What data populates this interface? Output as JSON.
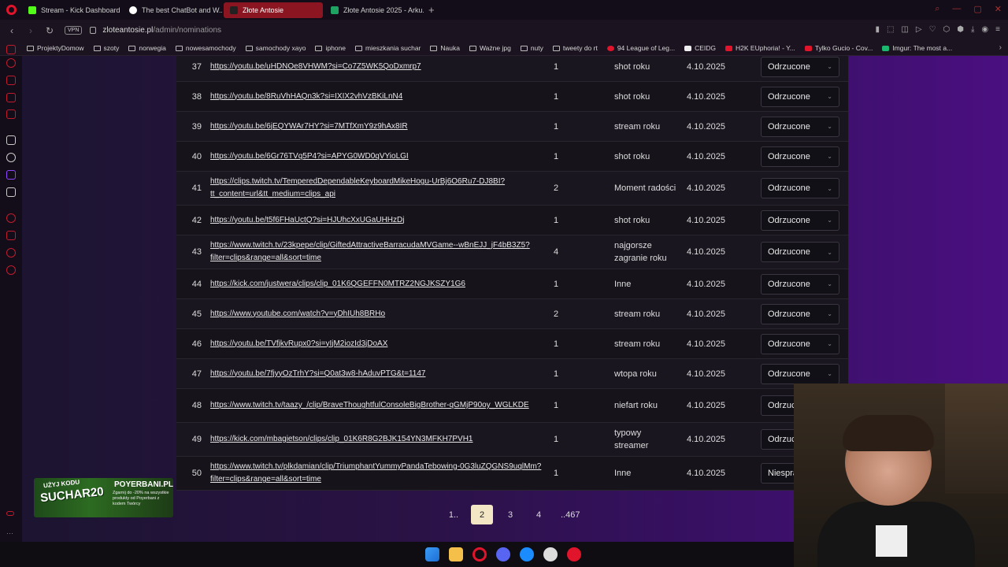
{
  "browser": {
    "tabs": [
      {
        "label": "Stream - Kick Dashboard",
        "favicon_color": "#53fc18"
      },
      {
        "label": "The best ChatBot and W...",
        "favicon_color": "#ffffff"
      },
      {
        "label": "Złote Antosie",
        "favicon_color": "#222222"
      },
      {
        "label": "Złote Antosie 2025 - Arku...",
        "favicon_color": "#1ea362"
      }
    ],
    "url_host": "zloteantosie.pl",
    "url_path": "/admin/nominations",
    "vpn_label": "VPN",
    "bookmarks": [
      "ProjektyDomow",
      "szoty",
      "norwegia",
      "nowesamochody",
      "samochody xayo",
      "iphone",
      "mieszkania suchar",
      "Nauka",
      "Ważne jpg",
      "nuty",
      "tweety do rt",
      "94 League of Leg...",
      "CEIDG",
      "H2K EUphoria! - Y...",
      "Tylko Gucio - Cov...",
      "Imgur: The most a..."
    ]
  },
  "table": {
    "rows": [
      {
        "num": "37",
        "url": "https://youtu.be/uHDNOe8VHWM?si=Co7Z5WK5QoDxmrp7",
        "count": "1",
        "category": "shot roku",
        "date": "4.10.2025",
        "status": "Odrzucone"
      },
      {
        "num": "38",
        "url": "https://youtu.be/8RuVhHAQn3k?si=IXIX2vhVzBKiLnN4",
        "count": "1",
        "category": "shot roku",
        "date": "4.10.2025",
        "status": "Odrzucone"
      },
      {
        "num": "39",
        "url": "https://youtu.be/6jEQYWAr7HY?si=7MTfXmY9z9hAx8IR",
        "count": "1",
        "category": "stream roku",
        "date": "4.10.2025",
        "status": "Odrzucone"
      },
      {
        "num": "40",
        "url": "https://youtu.be/6Gr76TVq5P4?si=APYG0WD0qVYioLGI",
        "count": "1",
        "category": "shot roku",
        "date": "4.10.2025",
        "status": "Odrzucone"
      },
      {
        "num": "41",
        "url": "https://clips.twitch.tv/TemperedDependableKeyboardMikeHogu-UrBj6O6Ru7-DJ8BI?tt_content=url&tt_medium=clips_api",
        "count": "2",
        "category": "Moment radości",
        "date": "4.10.2025",
        "status": "Odrzucone"
      },
      {
        "num": "42",
        "url": "https://youtu.be/t5f6FHaUctQ?si=HJUhcXxUGaUHHzDj",
        "count": "1",
        "category": "shot roku",
        "date": "4.10.2025",
        "status": "Odrzucone"
      },
      {
        "num": "43",
        "url": "https://www.twitch.tv/23kpepe/clip/GiftedAttractiveBarracudaMVGame--wBnEJJ_jF4bB3Z5?filter=clips&range=all&sort=time",
        "count": "4",
        "category": "najgorsze zagranie roku",
        "date": "4.10.2025",
        "status": "Odrzucone"
      },
      {
        "num": "44",
        "url": "https://kick.com/justwera/clips/clip_01K6QGEFFN0MTRZ2NGJKSZY1G6",
        "count": "1",
        "category": "Inne",
        "date": "4.10.2025",
        "status": "Odrzucone"
      },
      {
        "num": "45",
        "url": "https://www.youtube.com/watch?v=yDhIUh8BRHo",
        "count": "2",
        "category": "stream roku",
        "date": "4.10.2025",
        "status": "Odrzucone"
      },
      {
        "num": "46",
        "url": "https://youtu.be/TVfjkvRupx0?si=yIjM2iozId3jDoAX",
        "count": "1",
        "category": "stream roku",
        "date": "4.10.2025",
        "status": "Odrzucone"
      },
      {
        "num": "47",
        "url": "https://youtu.be/7fjyyOzTrhY?si=Q0at3w8-hAduvPTG&t=1147",
        "count": "1",
        "category": "wtopa roku",
        "date": "4.10.2025",
        "status": "Odrzucone"
      },
      {
        "num": "48",
        "url": "https://www.twitch.tv/taazy_/clip/BraveThoughtfulConsoleBigBrother-qGMjP90oy_WGLKDE",
        "count": "1",
        "category": "niefart roku",
        "date": "4.10.2025",
        "status": "Odrzuc"
      },
      {
        "num": "49",
        "url": "https://kick.com/mbagietson/clips/clip_01K6R8G2BJK154YN3MFKH7PVH1",
        "count": "1",
        "category": "typowy streamer",
        "date": "4.10.2025",
        "status": "Odrzuc"
      },
      {
        "num": "50",
        "url": "https://www.twitch.tv/plkdamian/clip/TriumphantYummyPandaTebowing-0G3luZQGNS9uqlMm?filter=clips&range=all&sort=time",
        "count": "1",
        "category": "Inne",
        "date": "4.10.2025",
        "status": "Niespra"
      }
    ]
  },
  "pagination": {
    "pages": [
      "1..",
      "2",
      "3",
      "4",
      "..467"
    ],
    "active": "2"
  },
  "ad": {
    "code_top": "UŻYJ KODU",
    "code": "SUCHAR20",
    "brand": "POYERBANI.PL",
    "description": "Zgarnij do -20% na wszystkie produkty od Poyerbani z kodem Twórcy"
  }
}
